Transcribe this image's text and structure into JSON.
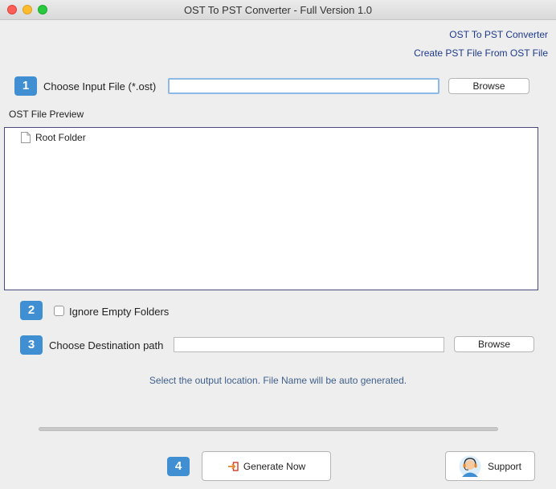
{
  "window": {
    "title": "OST To PST Converter - Full Version 1.0"
  },
  "header": {
    "link1": "OST To PST Converter",
    "link2": "Create PST File From OST File"
  },
  "step1": {
    "number": "1",
    "label": "Choose Input File (*.ost)",
    "input_value": "",
    "browse_label": "Browse"
  },
  "preview": {
    "heading": "OST File Preview",
    "tree": [
      {
        "label": "Root Folder",
        "icon": "document-icon"
      }
    ]
  },
  "step2": {
    "number": "2",
    "checkbox_label": "Ignore Empty Folders",
    "checked": false
  },
  "step3": {
    "number": "3",
    "label": "Choose Destination path",
    "input_value": "",
    "browse_label": "Browse"
  },
  "hint": "Select the output location. File Name will be auto generated.",
  "progress": {
    "value": 0
  },
  "step4": {
    "number": "4",
    "generate_label": "Generate Now",
    "generate_icon": "export-icon",
    "support_label": "Support",
    "support_icon": "headset-agent-icon"
  },
  "colors": {
    "accent": "#3f8fd2",
    "link": "#1e3a8a",
    "hint": "#3f5f8a"
  }
}
